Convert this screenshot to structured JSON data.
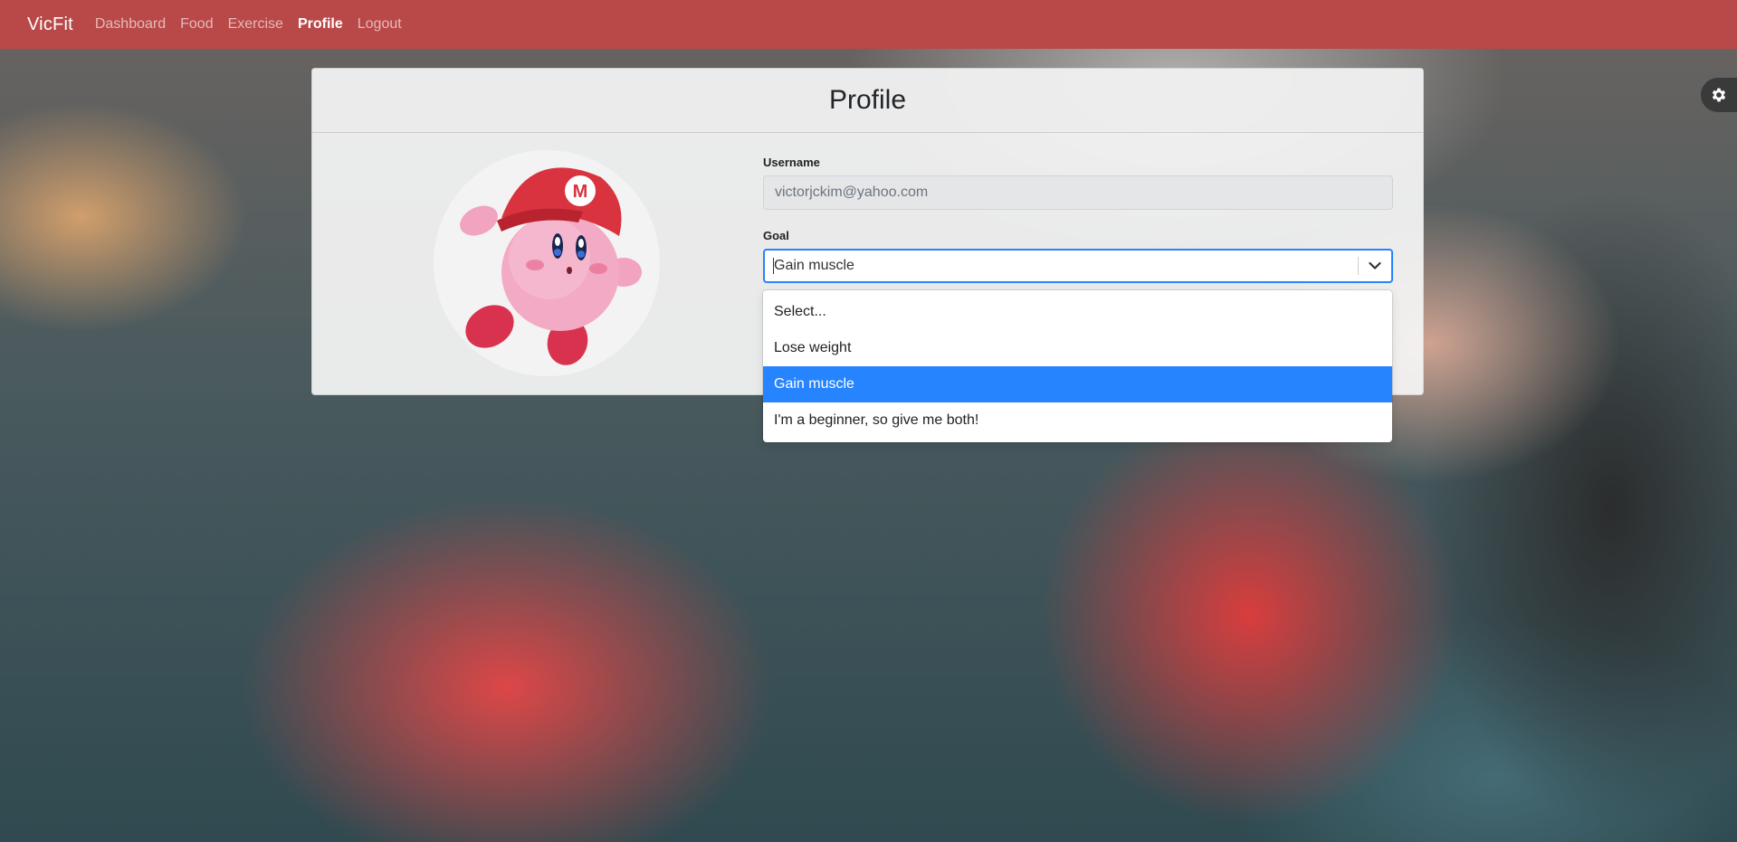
{
  "navbar": {
    "brand": "VicFit",
    "links": [
      {
        "label": "Dashboard"
      },
      {
        "label": "Food"
      },
      {
        "label": "Exercise"
      },
      {
        "label": "Profile",
        "active": true
      },
      {
        "label": "Logout"
      }
    ],
    "background_color": "#b94848"
  },
  "profile": {
    "title": "Profile",
    "avatar_icon": "kirby-mario-hat-avatar",
    "username": {
      "label": "Username",
      "value": "victorjckim@yahoo.com"
    },
    "goal": {
      "label": "Goal",
      "value": "Gain muscle",
      "options": [
        {
          "label": "Select..."
        },
        {
          "label": "Lose weight"
        },
        {
          "label": "Gain muscle",
          "selected": true
        },
        {
          "label": "I'm a beginner, so give me both!"
        }
      ]
    }
  },
  "settings_tab": {
    "icon": "gear-icon"
  },
  "colors": {
    "accent_blue": "#2684ff",
    "nav_red": "#b94848"
  }
}
